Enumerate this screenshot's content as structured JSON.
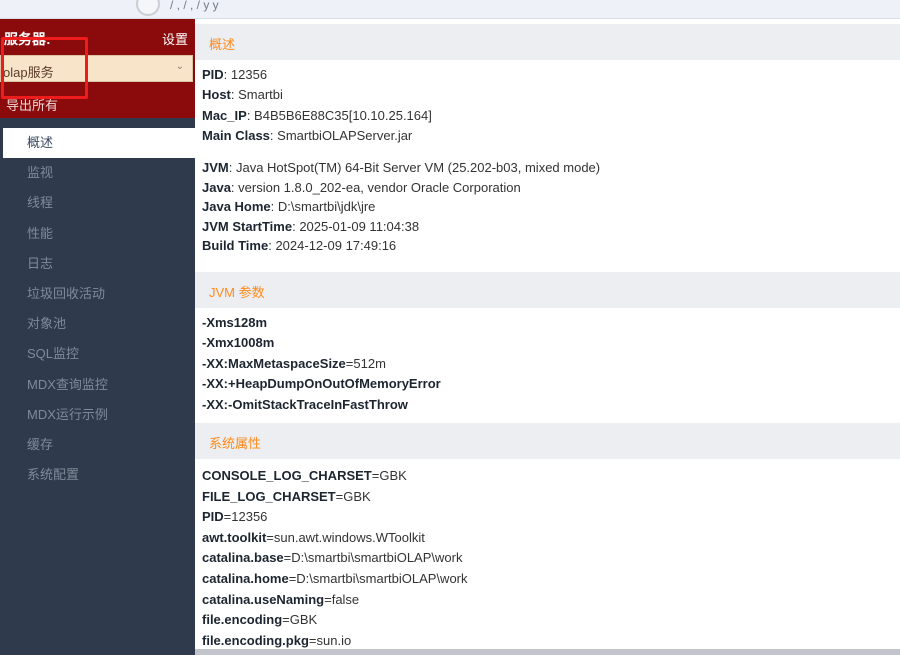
{
  "browser": {
    "path_fragment": "/ ,    /  ,    / y    y "
  },
  "sidebar": {
    "server_label": "服务器:",
    "settings": "设置",
    "server_select": "olap服务",
    "export": "导出所有",
    "nav": [
      {
        "label": "概述",
        "active": true
      },
      {
        "label": "监视"
      },
      {
        "label": "线程"
      },
      {
        "label": "性能"
      },
      {
        "label": "日志"
      },
      {
        "label": "垃圾回收活动"
      },
      {
        "label": "对象池"
      },
      {
        "label": "SQL监控"
      },
      {
        "label": "MDX查询监控"
      },
      {
        "label": "MDX运行示例"
      },
      {
        "label": "缓存"
      },
      {
        "label": "系统配置"
      }
    ]
  },
  "overview": {
    "title": "概述",
    "basic": [
      {
        "k": "PID",
        "v": "12356"
      },
      {
        "k": "Host",
        "v": "Smartbi"
      },
      {
        "k": "Mac_IP",
        "v": "B4B5B6E88C35[10.10.25.164]"
      },
      {
        "k": "Main Class",
        "v": "SmartbiOLAPServer.jar"
      }
    ],
    "jvm": [
      {
        "k": "JVM",
        "v": "Java HotSpot(TM) 64-Bit Server VM (25.202-b03, mixed mode)"
      },
      {
        "k": "Java",
        "v": "version 1.8.0_202-ea, vendor Oracle Corporation"
      },
      {
        "k": "Java Home",
        "v": "D:\\smartbi\\jdk\\jre"
      },
      {
        "k": "JVM StartTime",
        "v": "2025-01-09 11:04:38"
      },
      {
        "k": "Build Time",
        "v": "2024-12-09 17:49:16"
      }
    ]
  },
  "jvm_params": {
    "title": "JVM 参数",
    "args": [
      {
        "k": "-Xms128m",
        "v": ""
      },
      {
        "k": "-Xmx1008m",
        "v": ""
      },
      {
        "k": "-XX:MaxMetaspaceSize",
        "v": "=512m"
      },
      {
        "k": "-XX:+HeapDumpOnOutOfMemoryError",
        "v": ""
      },
      {
        "k": "-XX:-OmitStackTraceInFastThrow",
        "v": ""
      }
    ]
  },
  "system_props": {
    "title": "系统属性",
    "props": [
      {
        "k": "CONSOLE_LOG_CHARSET",
        "v": "=GBK"
      },
      {
        "k": "FILE_LOG_CHARSET",
        "v": "=GBK"
      },
      {
        "k": "PID",
        "v": "=12356"
      },
      {
        "k": "awt.toolkit",
        "v": "=sun.awt.windows.WToolkit"
      },
      {
        "k": "catalina.base",
        "v": "=D:\\smartbi\\smartbiOLAP\\work"
      },
      {
        "k": "catalina.home",
        "v": "=D:\\smartbi\\smartbiOLAP\\work"
      },
      {
        "k": "catalina.useNaming",
        "v": "=false"
      },
      {
        "k": "file.encoding",
        "v": "=GBK"
      },
      {
        "k": "file.encoding.pkg",
        "v": "=sun.io"
      }
    ]
  },
  "colors": {
    "sidebar_bg": "#2f3b4c",
    "header_red": "#8b0a0c",
    "accent_orange": "#ff8a1c",
    "highlight_red": "#ee1c1c"
  }
}
